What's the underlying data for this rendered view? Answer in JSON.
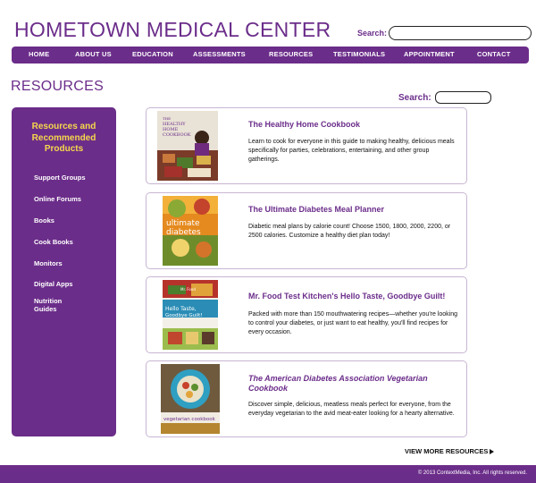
{
  "site": {
    "title": "HOMETOWN MEDICAL CENTER"
  },
  "top_search": {
    "label": "Search:",
    "value": ""
  },
  "nav": [
    {
      "label": "HOME"
    },
    {
      "label": "ABOUT US"
    },
    {
      "label": "EDUCATION"
    },
    {
      "label": "ASSESSMENTS"
    },
    {
      "label": "RESOURCES"
    },
    {
      "label": "TESTIMONIALS"
    },
    {
      "label": "APPOINTMENT"
    },
    {
      "label": "CONTACT"
    }
  ],
  "page": {
    "title": "RESOURCES"
  },
  "resources_search": {
    "label": "Search:",
    "value": ""
  },
  "sidebar": {
    "heading_lines": [
      "Resources and",
      "Recommended",
      "Products"
    ],
    "items": [
      {
        "label": "Support Groups"
      },
      {
        "label": "Online Forums"
      },
      {
        "label": "Books"
      },
      {
        "label": "Cook Books"
      },
      {
        "label": "Monitors"
      },
      {
        "label": "Digital Apps"
      },
      {
        "label": "Nutrition Guides"
      }
    ]
  },
  "products": [
    {
      "title": "The Healthy Home Cookbook",
      "description": "Learn to cook for everyone in this guide to making healthy, delicious meals specifically for parties, celebrations, entertaining, and other group gatherings.",
      "cover": {
        "line1": "THE",
        "line2": "HEALTHY",
        "line3": "HOME",
        "line4": "COOKBOOK"
      }
    },
    {
      "title": "The Ultimate Diabetes Meal Planner",
      "description": "Diabetic meal plans by calorie count! Choose 1500, 1800, 2000, 2200, or 2500 calories. Customize a healthy diet plan today!",
      "cover": {
        "line1": "ultimate",
        "line2": "diabetes"
      }
    },
    {
      "title": "Mr. Food Test Kitchen's Hello Taste, Goodbye Guilt!",
      "description": "Packed with more than 150 mouthwatering recipes—whether you're looking to control your diabetes, or just want to eat healthy, you'll find recipes for every occasion.",
      "cover": {
        "line1": "Mr. Food",
        "line2": "Hello Taste,",
        "line3": "Goodbye Guilt!"
      }
    },
    {
      "title": "The American Diabetes Association Vegetarian Cookbook",
      "description": "Discover simple, delicious, meatless meals perfect for everyone, from the everyday vegetarian to the avid meat-eater looking for a hearty alternative.",
      "cover": {
        "line1": "vegetarian cookbook"
      }
    }
  ],
  "view_more": {
    "label": "VIEW MORE RESOURCES"
  },
  "footer": {
    "text": "© 2013 ContextMedia, Inc. All rights reserved."
  },
  "colors": {
    "brand_purple": "#6b2d8a",
    "heading_yellow": "#f6d84b",
    "card_border": "#c8b6d3"
  }
}
